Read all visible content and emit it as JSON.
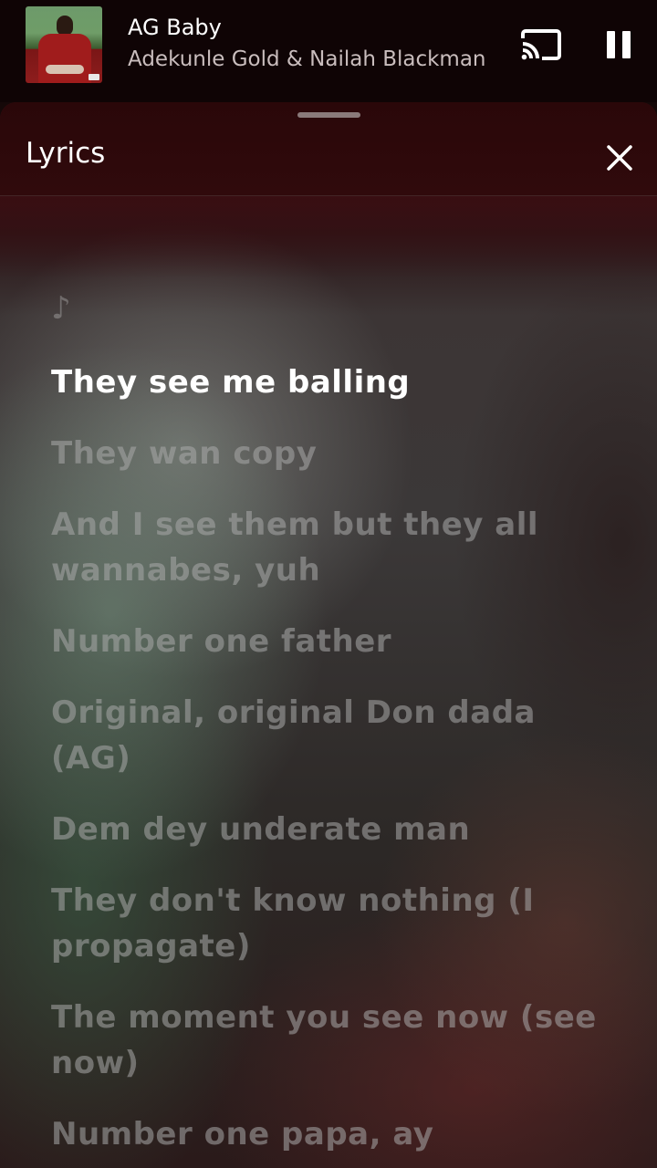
{
  "now_playing": {
    "title": "AG Baby",
    "artist": "Adekunle Gold & Nailah Blackman",
    "cast_icon": "cast-icon",
    "pause_icon": "pause-icon"
  },
  "sheet": {
    "title": "Lyrics",
    "close_icon": "close-icon"
  },
  "lyrics": {
    "intro_glyph": "♪",
    "active_index": 0,
    "lines": [
      "They see me balling",
      "They wan copy",
      "And I see them but they all wannabes, yuh",
      "Number one father",
      "Original, original Don dada (AG)",
      "Dem dey underate man",
      "They don't know nothing (I propagate)",
      "The moment you see now (see now)",
      "Number one papa, ay"
    ]
  },
  "colors": {
    "active_lyric": "#ffffff",
    "inactive_lyric": "rgba(170,170,170,0.55)",
    "header_bg": "#2a0709"
  }
}
